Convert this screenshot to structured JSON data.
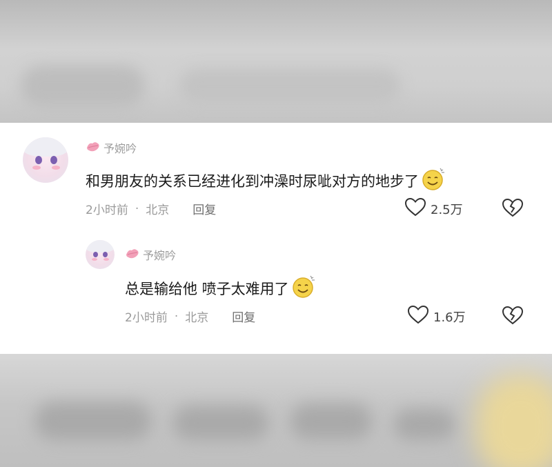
{
  "comments": [
    {
      "username": "予婉吟",
      "text": "和男朋友的关系已经进化到冲澡时尿呲对方的地步了",
      "emoji": "smile-emoji",
      "time": "2小时前",
      "separator": "·",
      "location": "北京",
      "reply_label": "回复",
      "likes": "2.5万"
    }
  ],
  "replies": [
    {
      "username": "予婉吟",
      "text": "总是输给他 喷子太难用了",
      "emoji": "smile-emoji",
      "time": "2小时前",
      "separator": "·",
      "location": "北京",
      "reply_label": "回复",
      "likes": "1.6万"
    }
  ],
  "icons": {
    "username_badge": "lips-icon",
    "like": "heart-icon",
    "dislike": "broken-heart-icon"
  },
  "colors": {
    "card_background": "#ffffff",
    "username": "#9c9c9c",
    "comment_text": "#1b1b1b",
    "meta_text": "#9a9a9a",
    "badge_pink": "#f2a0b8"
  }
}
